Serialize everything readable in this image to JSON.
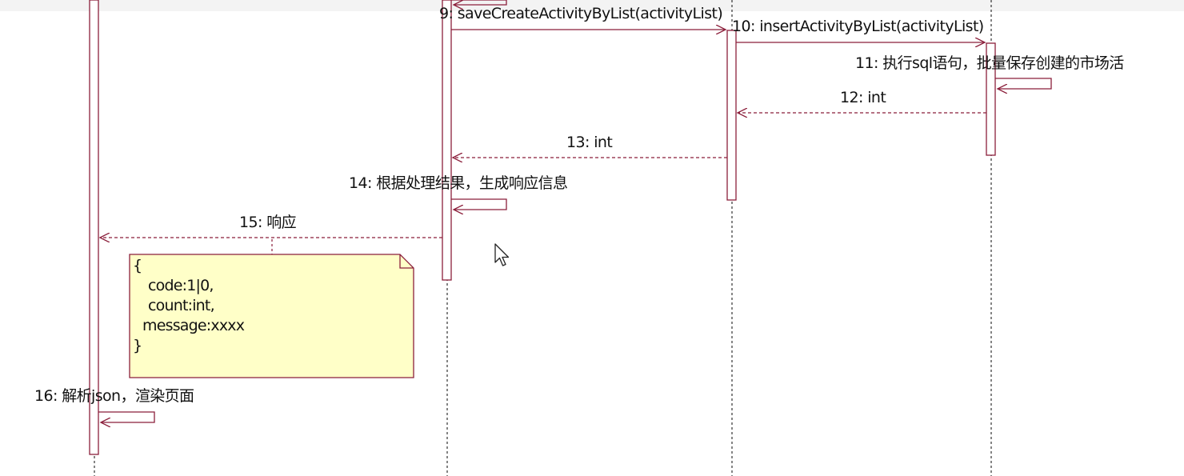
{
  "messages": {
    "m9": "9: saveCreateActivityByList(activityList)",
    "m10": "10: insertActivityByList(activityList)",
    "m11": "11: 执行sql语句，批量保存创建的市场活",
    "m12": "12: int",
    "m13": "13: int",
    "m14": "14: 根据处理结果，生成响应信息",
    "m15": "15: 响应",
    "m16": "16: 解析json，渲染页面"
  },
  "note": {
    "lines": [
      "{",
      "code:1|0,",
      "count:int,",
      "message:xxxx",
      "}"
    ]
  },
  "colors": {
    "message_line": "#8b1f3b",
    "activation_fill": "#ffffff",
    "activation_border": "#8b1f3b",
    "lifeline": "#333333",
    "note_fill": "#ffffc8",
    "note_border": "#8b1f3b"
  },
  "icons": {
    "pointer": "mouse-pointer-icon"
  }
}
